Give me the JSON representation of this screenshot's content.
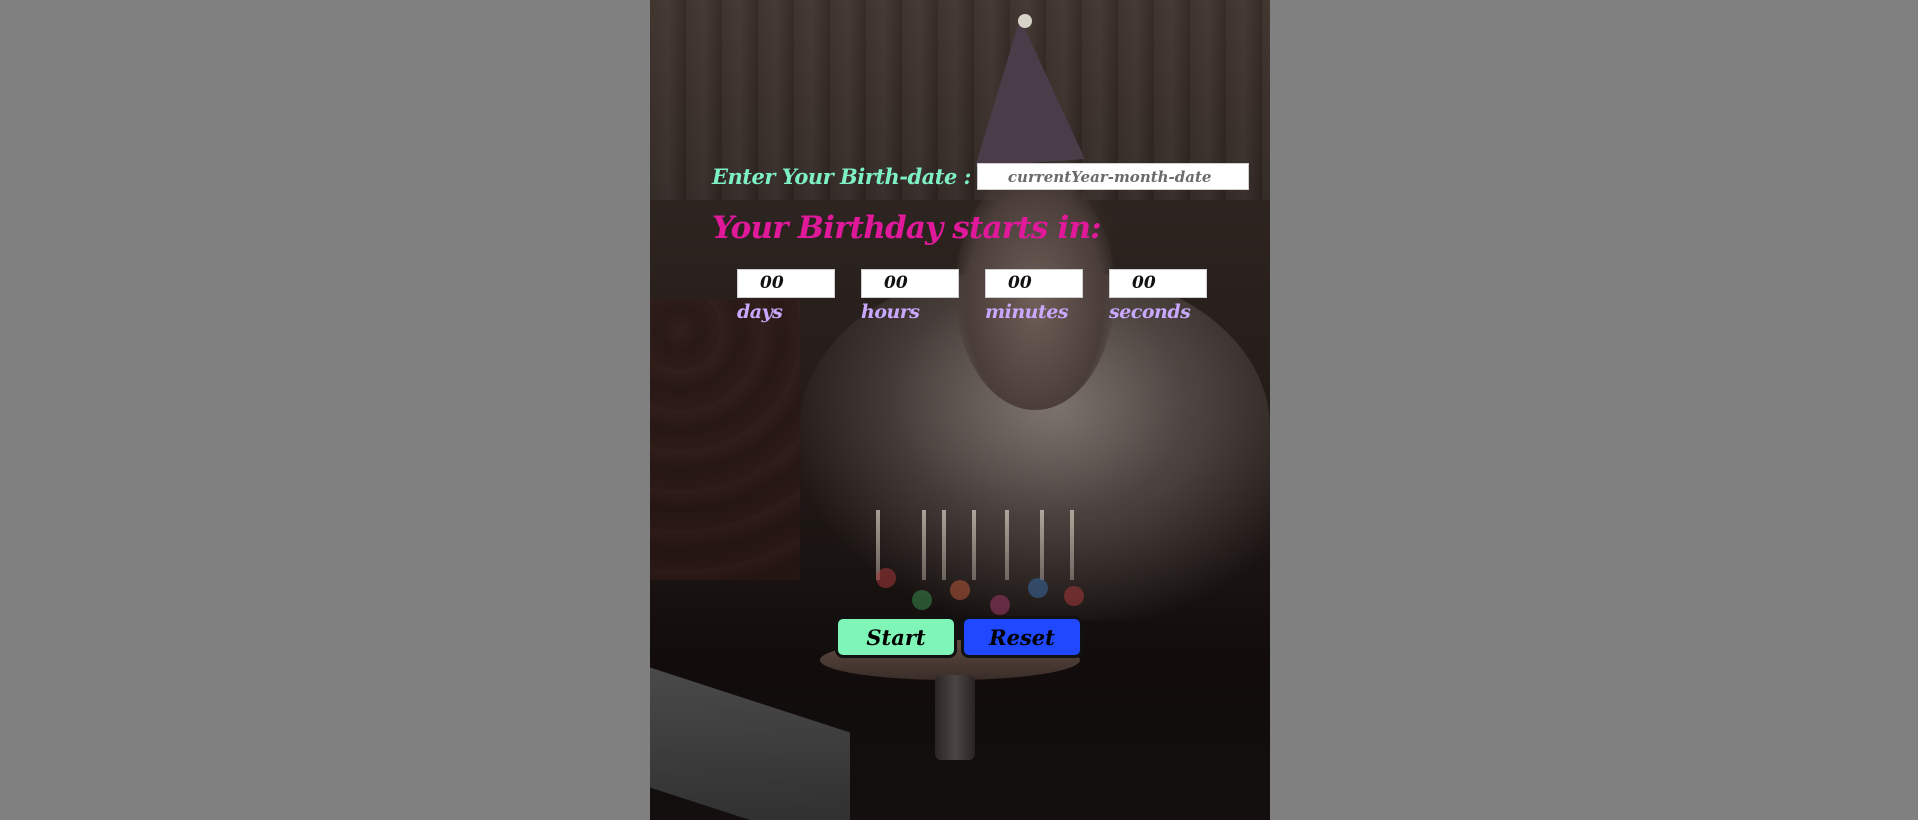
{
  "form": {
    "birth_label": "Enter Your Birth-date :",
    "birth_placeholder": "currentYear-month-date",
    "birth_value": ""
  },
  "heading": "Your Birthday starts in:",
  "timer": [
    {
      "value": "00",
      "unit": "days"
    },
    {
      "value": "00",
      "unit": "hours"
    },
    {
      "value": "00",
      "unit": "minutes"
    },
    {
      "value": "00",
      "unit": "seconds"
    }
  ],
  "buttons": {
    "start_label": "Start",
    "reset_label": "Reset"
  },
  "colors": {
    "page_background": "#808080",
    "label_accent": "#7df0c4",
    "heading_accent": "#e0199b",
    "unit_accent": "#c9a8ff",
    "start_button": "#7ff5b8",
    "reset_button": "#1f48ff"
  },
  "background_image": "birthday-candle-blowing-photo"
}
